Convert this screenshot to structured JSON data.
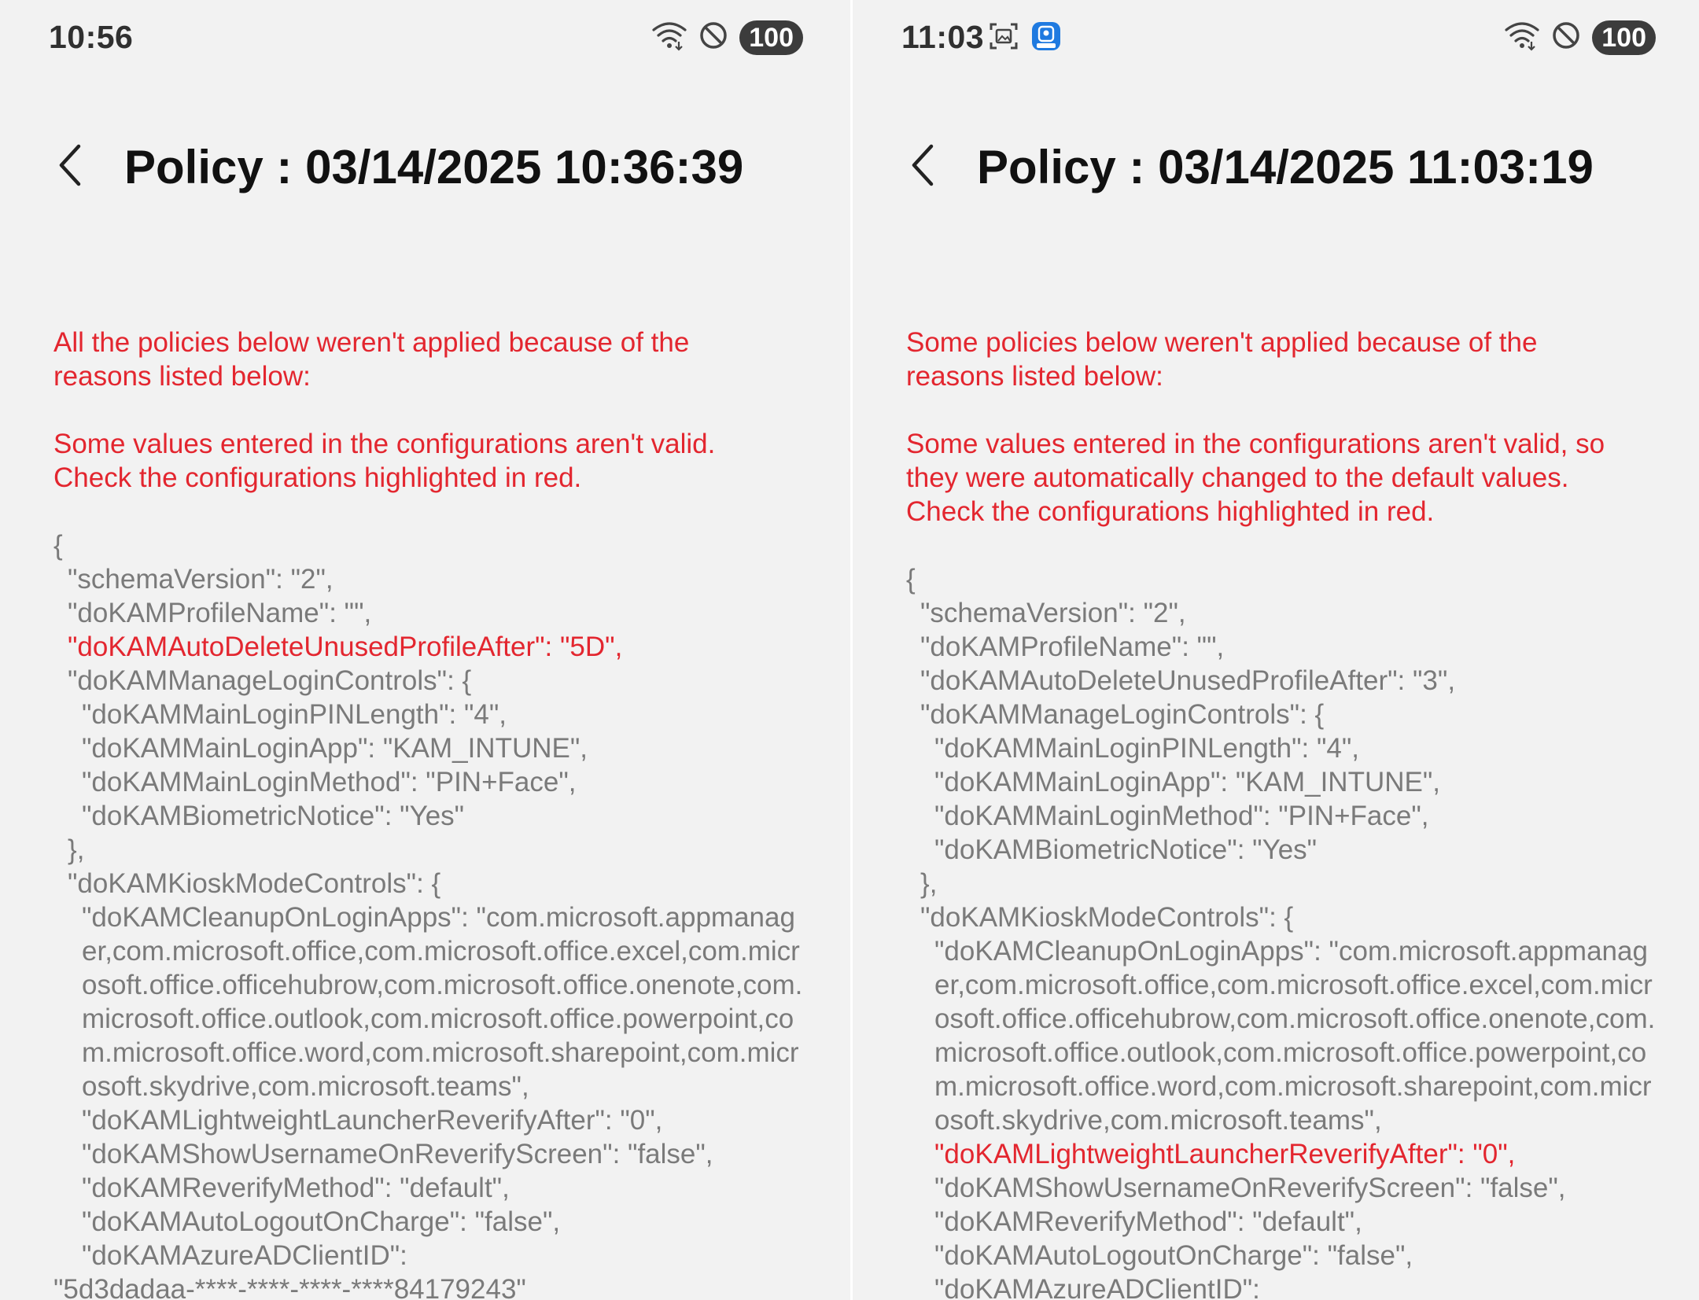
{
  "colors": {
    "error_red": "#e3262f",
    "json_gray": "#7a7a7a",
    "background": "#f2f2f2"
  },
  "left": {
    "status": {
      "time": "10:56",
      "battery": "100",
      "icons": [
        "wifi-icon",
        "do-not-disturb-icon"
      ]
    },
    "title": "Policy : 03/14/2025 10:36:39",
    "error_intro": "All the policies below weren't applied because of the\nreasons listed below:",
    "error_detail": "Some values entered in the configurations aren't valid.\nCheck the configurations highlighted in red.",
    "json_lines": [
      {
        "text": "{",
        "indent": 0,
        "highlight": false,
        "wrap": false
      },
      {
        "text": "\"schemaVersion\": \"2\",",
        "indent": 1,
        "highlight": false,
        "wrap": false
      },
      {
        "text": "\"doKAMProfileName\": \"\",",
        "indent": 1,
        "highlight": false,
        "wrap": false
      },
      {
        "text": "\"doKAMAutoDeleteUnusedProfileAfter\": \"5D\",",
        "indent": 1,
        "highlight": true,
        "wrap": false
      },
      {
        "text": "\"doKAMManageLoginControls\": {",
        "indent": 1,
        "highlight": false,
        "wrap": false
      },
      {
        "text": "\"doKAMMainLoginPINLength\": \"4\",",
        "indent": 2,
        "highlight": false,
        "wrap": false
      },
      {
        "text": "\"doKAMMainLoginApp\": \"KAM_INTUNE\",",
        "indent": 2,
        "highlight": false,
        "wrap": false
      },
      {
        "text": "\"doKAMMainLoginMethod\": \"PIN+Face\",",
        "indent": 2,
        "highlight": false,
        "wrap": false
      },
      {
        "text": "\"doKAMBiometricNotice\": \"Yes\"",
        "indent": 2,
        "highlight": false,
        "wrap": false
      },
      {
        "text": "},",
        "indent": 1,
        "highlight": false,
        "wrap": false
      },
      {
        "text": "\"doKAMKioskModeControls\": {",
        "indent": 1,
        "highlight": false,
        "wrap": false
      },
      {
        "text": "\"doKAMCleanupOnLoginApps\": \"com.microsoft.appmanager,com.microsoft.office,com.microsoft.office.excel,com.microsoft.office.officehubrow,com.microsoft.office.onenote,com.microsoft.office.outlook,com.microsoft.office.powerpoint,com.microsoft.office.word,com.microsoft.sharepoint,com.microsoft.skydrive,com.microsoft.teams\",",
        "indent": 2,
        "highlight": false,
        "wrap": true
      },
      {
        "text": "\"doKAMLightweightLauncherReverifyAfter\": \"0\",",
        "indent": 2,
        "highlight": false,
        "wrap": false
      },
      {
        "text": "\"doKAMShowUsernameOnReverifyScreen\": \"false\",",
        "indent": 2,
        "highlight": false,
        "wrap": false
      },
      {
        "text": "\"doKAMReverifyMethod\": \"default\",",
        "indent": 2,
        "highlight": false,
        "wrap": false
      },
      {
        "text": "\"doKAMAutoLogoutOnCharge\": \"false\",",
        "indent": 2,
        "highlight": false,
        "wrap": false
      },
      {
        "text": "\"doKAMAzureADClientID\":",
        "indent": 2,
        "highlight": false,
        "wrap": false
      },
      {
        "text": "\"5d3dadaa-****-****-****-****84179243\"",
        "indent": 0,
        "highlight": false,
        "wrap": false
      }
    ]
  },
  "right": {
    "status": {
      "time": "11:03",
      "battery": "100",
      "icons": [
        "screenshot-icon",
        "beta-app-icon",
        "wifi-icon",
        "do-not-disturb-icon"
      ]
    },
    "title": "Policy : 03/14/2025 11:03:19",
    "error_intro": "Some policies below weren't applied because of the\nreasons listed below:",
    "error_detail": "Some values entered in the configurations aren't valid, so\nthey were automatically changed to the default values.\nCheck the configurations highlighted in red.",
    "json_lines": [
      {
        "text": "{",
        "indent": 0,
        "highlight": false,
        "wrap": false
      },
      {
        "text": "\"schemaVersion\": \"2\",",
        "indent": 1,
        "highlight": false,
        "wrap": false
      },
      {
        "text": "\"doKAMProfileName\": \"\",",
        "indent": 1,
        "highlight": false,
        "wrap": false
      },
      {
        "text": "\"doKAMAutoDeleteUnusedProfileAfter\": \"3\",",
        "indent": 1,
        "highlight": false,
        "wrap": false
      },
      {
        "text": "\"doKAMManageLoginControls\": {",
        "indent": 1,
        "highlight": false,
        "wrap": false
      },
      {
        "text": "\"doKAMMainLoginPINLength\": \"4\",",
        "indent": 2,
        "highlight": false,
        "wrap": false
      },
      {
        "text": "\"doKAMMainLoginApp\": \"KAM_INTUNE\",",
        "indent": 2,
        "highlight": false,
        "wrap": false
      },
      {
        "text": "\"doKAMMainLoginMethod\": \"PIN+Face\",",
        "indent": 2,
        "highlight": false,
        "wrap": false
      },
      {
        "text": "\"doKAMBiometricNotice\": \"Yes\"",
        "indent": 2,
        "highlight": false,
        "wrap": false
      },
      {
        "text": "},",
        "indent": 1,
        "highlight": false,
        "wrap": false
      },
      {
        "text": "\"doKAMKioskModeControls\": {",
        "indent": 1,
        "highlight": false,
        "wrap": false
      },
      {
        "text": "\"doKAMCleanupOnLoginApps\": \"com.microsoft.appmanager,com.microsoft.office,com.microsoft.office.excel,com.microsoft.office.officehubrow,com.microsoft.office.onenote,com.microsoft.office.outlook,com.microsoft.office.powerpoint,com.microsoft.office.word,com.microsoft.sharepoint,com.microsoft.skydrive,com.microsoft.teams\",",
        "indent": 2,
        "highlight": false,
        "wrap": true
      },
      {
        "text": "\"doKAMLightweightLauncherReverifyAfter\": \"0\",",
        "indent": 2,
        "highlight": true,
        "wrap": false
      },
      {
        "text": "\"doKAMShowUsernameOnReverifyScreen\": \"false\",",
        "indent": 2,
        "highlight": false,
        "wrap": false
      },
      {
        "text": "\"doKAMReverifyMethod\": \"default\",",
        "indent": 2,
        "highlight": false,
        "wrap": false
      },
      {
        "text": "\"doKAMAutoLogoutOnCharge\": \"false\",",
        "indent": 2,
        "highlight": false,
        "wrap": false
      },
      {
        "text": "\"doKAMAzureADClientID\":",
        "indent": 2,
        "highlight": false,
        "wrap": false
      }
    ]
  }
}
